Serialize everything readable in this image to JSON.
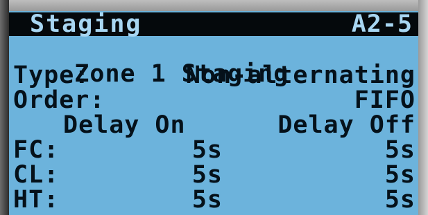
{
  "screen": {
    "title": "Staging",
    "code": "A2-5",
    "zone_label": "Zone 1 Staging",
    "type_label": "Type:",
    "type_value": "Non-alternating",
    "order_label": "Order:",
    "order_value": "FIFO",
    "col_delay_on": "Delay On",
    "col_delay_off": "Delay Off",
    "rows": [
      {
        "label": "FC:",
        "on": "5s",
        "off": "5s"
      },
      {
        "label": "CL:",
        "on": "5s",
        "off": "5s"
      },
      {
        "label": "HT:",
        "on": "5s",
        "off": "5s"
      }
    ]
  },
  "colors": {
    "screen_bg": "#6cb3dc",
    "text": "#05111a",
    "header_bg": "#05090c",
    "header_text": "#a8d6f2"
  }
}
